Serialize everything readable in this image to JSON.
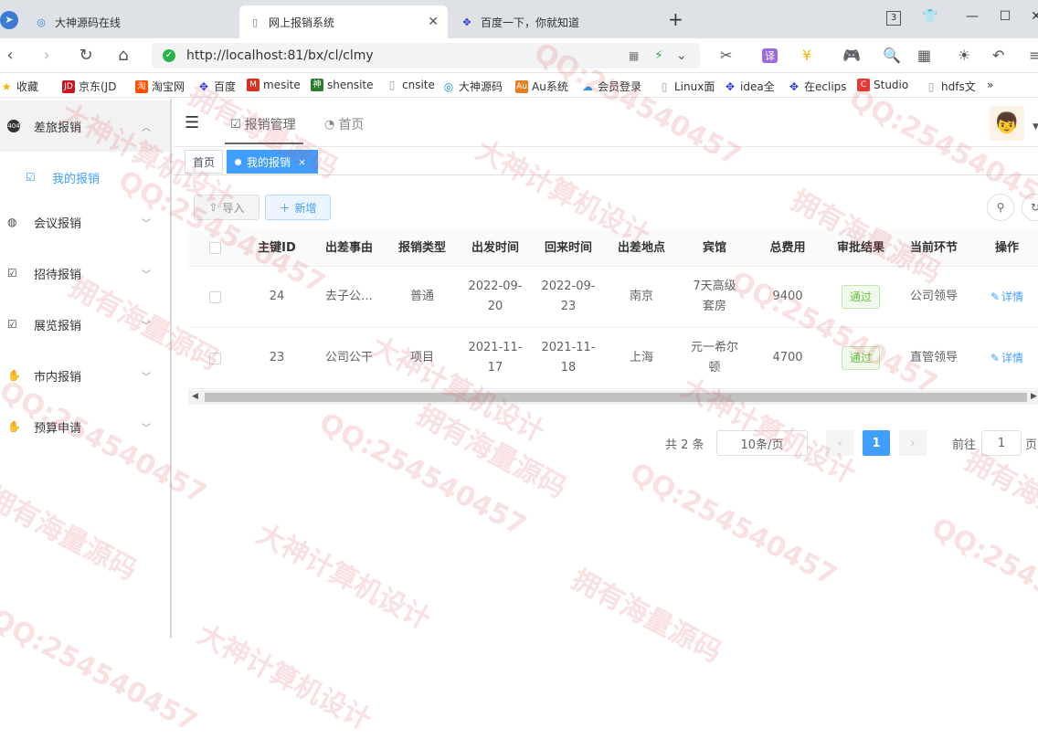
{
  "browser": {
    "tabs": [
      {
        "title": "大神源码在线",
        "active": false
      },
      {
        "title": "网上报销系统",
        "active": true
      },
      {
        "title": "百度一下，你就知道",
        "active": false
      }
    ],
    "new_tab": "+",
    "tab_count": "3",
    "url": "http://localhost:81/bx/cl/clmy",
    "bookmarks": [
      {
        "label": "收藏",
        "icon": "star-icon",
        "color": "#f4b400"
      },
      {
        "label": "京东(JD",
        "icon": "jd-icon",
        "color": "#c81623"
      },
      {
        "label": "淘宝网",
        "icon": "taobao-icon",
        "color": "#ff5000"
      },
      {
        "label": "百度",
        "icon": "baidu-paw-icon",
        "color": "#2932e1"
      },
      {
        "label": "mesite",
        "icon": "mesite-icon",
        "color": "#d93025"
      },
      {
        "label": "shensite",
        "icon": "shensite-icon",
        "color": "#2e7d32"
      },
      {
        "label": "cnsite",
        "icon": "page-icon",
        "color": "#9e9e9e"
      },
      {
        "label": "大神源码",
        "icon": "globe-icon",
        "color": "#1e88e5"
      },
      {
        "label": "Au系统",
        "icon": "au-icon",
        "color": "#e67e22"
      },
      {
        "label": "会员登录",
        "icon": "cloud-icon",
        "color": "#2196f3"
      },
      {
        "label": "Linux面",
        "icon": "page-icon",
        "color": "#9e9e9e"
      },
      {
        "label": "idea全",
        "icon": "baidu-paw-icon",
        "color": "#2932e1"
      },
      {
        "label": "在eclips",
        "icon": "baidu-paw-icon",
        "color": "#2932e1"
      },
      {
        "label": "Studio",
        "icon": "studio-icon",
        "color": "#e53935"
      },
      {
        "label": "hdfs文",
        "icon": "page-icon",
        "color": "#9e9e9e"
      }
    ],
    "bookmarks_more": "»"
  },
  "sidebar": {
    "menus": [
      {
        "label": "差旅报销",
        "icon": "404-icon",
        "open": true
      },
      {
        "label": "会议报销",
        "icon": "compass-icon"
      },
      {
        "label": "招待报销",
        "icon": "checkbox-icon"
      },
      {
        "label": "展览报销",
        "icon": "checkbox-icon"
      },
      {
        "label": "市内报销",
        "icon": "hand-icon"
      },
      {
        "label": "预算申请",
        "icon": "hand-icon"
      }
    ],
    "submenu": {
      "label": "我的报销",
      "icon": "checkbox-icon"
    }
  },
  "topbar": {
    "breadcrumbs": [
      {
        "label": "报销管理",
        "icon": "checkbox-icon"
      },
      {
        "label": "首页",
        "icon": "dashboard-icon"
      }
    ]
  },
  "tags": [
    {
      "label": "首页",
      "active": false
    },
    {
      "label": "我的报销",
      "active": true,
      "close": "×"
    }
  ],
  "toolbar": {
    "import_label": "导入",
    "add_label": "新增"
  },
  "table": {
    "columns": [
      "主键ID",
      "出差事由",
      "报销类型",
      "出发时间",
      "回来时间",
      "出差地点",
      "宾馆",
      "总费用",
      "审批结果",
      "当前环节",
      "操作"
    ],
    "rows": [
      {
        "id": "24",
        "reason": "去子公…",
        "type": "普通",
        "depart_a": "2022-09-",
        "depart_b": "20",
        "return_a": "2022-09-",
        "return_b": "23",
        "place": "南京",
        "hotel_a": "7天高级",
        "hotel_b": "套房",
        "cost": "9400",
        "result": "通过",
        "stage": "公司领导",
        "action": "详情"
      },
      {
        "id": "23",
        "reason": "公司公干",
        "type": "项目",
        "depart_a": "2021-11-",
        "depart_b": "17",
        "return_a": "2021-11-",
        "return_b": "18",
        "place": "上海",
        "hotel_a": "元一希尔",
        "hotel_b": "顿",
        "cost": "4700",
        "result": "通过",
        "stage": "直管领导",
        "action": "详情"
      }
    ]
  },
  "pagination": {
    "total": "共 2 条",
    "page_size": "10条/页",
    "current_page": "1",
    "goto_label": "前往",
    "goto_value": "1",
    "page_suffix": "页"
  },
  "watermarks": {
    "qq": "QQ:254540457",
    "brand": "大神计算机设计",
    "slogan": "拥有海量源码"
  }
}
